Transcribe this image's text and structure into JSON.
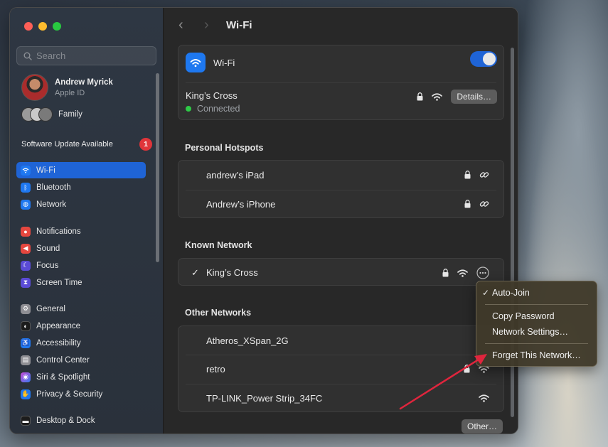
{
  "window": {
    "title": "Wi-Fi"
  },
  "sidebar": {
    "search_placeholder": "Search",
    "profile": {
      "name": "Andrew Myrick",
      "subtitle": "Apple ID"
    },
    "family_label": "Family",
    "update": {
      "label": "Software Update Available",
      "count": "1"
    },
    "groups": [
      [
        {
          "label": "Wi-Fi",
          "icon": "wifi-icon",
          "color": "#1f78f0",
          "active": true
        },
        {
          "label": "Bluetooth",
          "icon": "bluetooth-icon",
          "color": "#1f78f0"
        },
        {
          "label": "Network",
          "icon": "globe-icon",
          "color": "#1f78f0"
        }
      ],
      [
        {
          "label": "Notifications",
          "icon": "bell-icon",
          "color": "#e5473f"
        },
        {
          "label": "Sound",
          "icon": "speaker-icon",
          "color": "#e5473f"
        },
        {
          "label": "Focus",
          "icon": "moon-icon",
          "color": "#5b4bd6"
        },
        {
          "label": "Screen Time",
          "icon": "hourglass-icon",
          "color": "#5b4bd6"
        }
      ],
      [
        {
          "label": "General",
          "icon": "gear-icon",
          "color": "#8e8e93"
        },
        {
          "label": "Appearance",
          "icon": "appearance-icon",
          "color": "#1c1c1c"
        },
        {
          "label": "Accessibility",
          "icon": "accessibility-icon",
          "color": "#1f78f0"
        },
        {
          "label": "Control Center",
          "icon": "control-center-icon",
          "color": "#8e8e93"
        },
        {
          "label": "Siri & Spotlight",
          "icon": "siri-icon",
          "color": "#c84bd6"
        },
        {
          "label": "Privacy & Security",
          "icon": "hand-icon",
          "color": "#1f78f0"
        }
      ],
      [
        {
          "label": "Desktop & Dock",
          "icon": "dock-icon",
          "color": "#1c1c1c"
        }
      ]
    ]
  },
  "main": {
    "wifi_row_label": "Wi-Fi",
    "wifi_enabled": true,
    "current_network": {
      "name": "King’s Cross",
      "status": "Connected",
      "details_button": "Details…"
    },
    "hotspots_title": "Personal Hotspots",
    "hotspots": [
      "andrew’s iPad",
      "Andrew’s iPhone"
    ],
    "known_title": "Known Network",
    "known": [
      {
        "name": "King’s Cross",
        "checked": "✓"
      }
    ],
    "other_title": "Other Networks",
    "other": [
      {
        "name": "Atheros_XSpan_2G",
        "locked": false
      },
      {
        "name": "retro",
        "locked": true
      },
      {
        "name": "TP-LINK_Power Strip_34FC",
        "locked": false
      }
    ],
    "other_button": "Other…"
  },
  "context_menu": {
    "items": [
      {
        "label": "Auto-Join",
        "checked": "✓"
      },
      {
        "label": "Copy Password"
      },
      {
        "label": "Network Settings…"
      },
      {
        "label": "Forget This Network…"
      }
    ]
  },
  "annotation": {
    "arrow_color": "#e0253d"
  }
}
